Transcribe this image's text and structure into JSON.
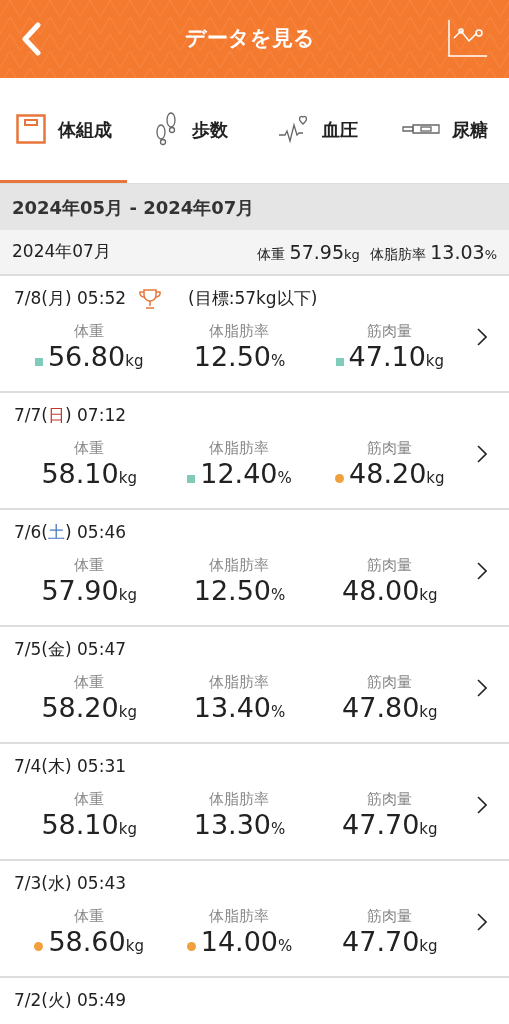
{
  "header": {
    "title": "データを見る"
  },
  "tabs": [
    {
      "label": "体組成",
      "kind": "scale",
      "selected": true
    },
    {
      "label": "歩数",
      "kind": "footprints",
      "selected": false
    },
    {
      "label": "血圧",
      "kind": "heartbeat",
      "selected": false
    },
    {
      "label": "尿糖",
      "kind": "strip",
      "selected": false
    }
  ],
  "range": "2024年05月 - 2024年07月",
  "month_summary": {
    "month": "2024年07月",
    "items": [
      {
        "label": "体重",
        "value": "57.95",
        "unit": "kg"
      },
      {
        "label": "体脂肪率",
        "value": "13.03",
        "unit": "%"
      }
    ]
  },
  "records": [
    {
      "date_prefix": "7/8(",
      "weekday": "月",
      "color": "#222222",
      "date_suffix": ") 05:52",
      "goal": "(目標:57kg以下)",
      "metrics": [
        {
          "label": "体重",
          "value": "56.80",
          "unit": "kg",
          "kind": "square",
          "color": "#80cbb9"
        },
        {
          "label": "体脂肪率",
          "value": "12.50",
          "unit": "%",
          "kind": "plain"
        },
        {
          "label": "筋肉量",
          "value": "47.10",
          "unit": "kg",
          "kind": "square",
          "color": "#80cbb9"
        }
      ]
    },
    {
      "date_prefix": "7/7(",
      "weekday": "日",
      "color": "#c0392b",
      "date_suffix": ") 07:12",
      "metrics": [
        {
          "label": "体重",
          "value": "58.10",
          "unit": "kg",
          "kind": "plain"
        },
        {
          "label": "体脂肪率",
          "value": "12.40",
          "unit": "%",
          "kind": "square",
          "color": "#80cbb9"
        },
        {
          "label": "筋肉量",
          "value": "48.20",
          "unit": "kg",
          "kind": "circle",
          "color": "#f0a03c"
        }
      ]
    },
    {
      "date_prefix": "7/6(",
      "weekday": "土",
      "color": "#4a78c0",
      "date_suffix": ") 05:46",
      "metrics": [
        {
          "label": "体重",
          "value": "57.90",
          "unit": "kg",
          "kind": "plain"
        },
        {
          "label": "体脂肪率",
          "value": "12.50",
          "unit": "%",
          "kind": "plain"
        },
        {
          "label": "筋肉量",
          "value": "48.00",
          "unit": "kg",
          "kind": "plain"
        }
      ]
    },
    {
      "date_prefix": "7/5(",
      "weekday": "金",
      "color": "#222222",
      "date_suffix": ") 05:47",
      "metrics": [
        {
          "label": "体重",
          "value": "58.20",
          "unit": "kg",
          "kind": "plain"
        },
        {
          "label": "体脂肪率",
          "value": "13.40",
          "unit": "%",
          "kind": "plain"
        },
        {
          "label": "筋肉量",
          "value": "47.80",
          "unit": "kg",
          "kind": "plain"
        }
      ]
    },
    {
      "date_prefix": "7/4(",
      "weekday": "木",
      "color": "#222222",
      "date_suffix": ") 05:31",
      "metrics": [
        {
          "label": "体重",
          "value": "58.10",
          "unit": "kg",
          "kind": "plain"
        },
        {
          "label": "体脂肪率",
          "value": "13.30",
          "unit": "%",
          "kind": "plain"
        },
        {
          "label": "筋肉量",
          "value": "47.70",
          "unit": "kg",
          "kind": "plain"
        }
      ]
    },
    {
      "date_prefix": "7/3(",
      "weekday": "水",
      "color": "#222222",
      "date_suffix": ") 05:43",
      "metrics": [
        {
          "label": "体重",
          "value": "58.60",
          "unit": "kg",
          "kind": "circle",
          "color": "#f0a03c"
        },
        {
          "label": "体脂肪率",
          "value": "14.00",
          "unit": "%",
          "kind": "circle",
          "color": "#f0a03c"
        },
        {
          "label": "筋肉量",
          "value": "47.70",
          "unit": "kg",
          "kind": "plain"
        }
      ]
    },
    {
      "date_prefix": "7/2(",
      "weekday": "火",
      "color": "#222222",
      "date_suffix": ") 05:49"
    }
  ]
}
